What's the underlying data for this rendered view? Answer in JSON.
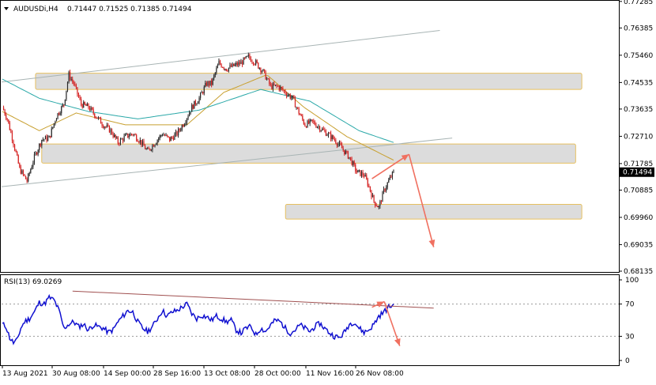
{
  "header": {
    "symbol": "AUDUSDi,H4",
    "ohlc": "0.71447 0.71525 0.71385 0.71494"
  },
  "rsi_header": "RSI(13) 69.0269",
  "current_price_label": "0.71494",
  "colors": {
    "candle_up": "#2a2a2a",
    "candle_down": "#d42020",
    "ma_fast": "#c8a030",
    "ma_slow": "#2aa8a8",
    "zone_fill": "#dcdcdc",
    "zone_border": "#e6c060",
    "trendline": "#a8b4b4",
    "arrow": "#f07060",
    "rsi_line": "#1010d0",
    "rsi_trendline": "#a05050",
    "price_tag_bg": "#000000"
  },
  "chart_data": [
    {
      "type": "candlestick",
      "symbol": "AUDUSDi",
      "timeframe": "H4",
      "ylim": [
        0.68135,
        0.7728
      ],
      "yticks": [
        "0.77285",
        "0.76385",
        "0.75460",
        "0.74535",
        "0.73635",
        "0.72710",
        "0.71785",
        "0.70885",
        "0.69960",
        "0.69035",
        "0.68135"
      ],
      "xticks": [
        "13 Aug 2021",
        "30 Aug 08:00",
        "14 Sep 00:00",
        "28 Sep 16:00",
        "13 Oct 08:00",
        "28 Oct 00:00",
        "11 Nov 16:00",
        "26 Nov 08:00"
      ],
      "approx_close_path": [
        [
          0,
          0.737
        ],
        [
          4,
          0.733
        ],
        [
          9,
          0.725
        ],
        [
          14,
          0.716
        ],
        [
          20,
          0.712
        ],
        [
          26,
          0.72
        ],
        [
          32,
          0.726
        ],
        [
          38,
          0.7265
        ],
        [
          44,
          0.734
        ],
        [
          50,
          0.738
        ],
        [
          54,
          0.748
        ],
        [
          58,
          0.745
        ],
        [
          64,
          0.738
        ],
        [
          70,
          0.737
        ],
        [
          76,
          0.734
        ],
        [
          82,
          0.731
        ],
        [
          88,
          0.729
        ],
        [
          94,
          0.725
        ],
        [
          100,
          0.727
        ],
        [
          106,
          0.728
        ],
        [
          112,
          0.7255
        ],
        [
          118,
          0.722
        ],
        [
          124,
          0.725
        ],
        [
          130,
          0.728
        ],
        [
          136,
          0.726
        ],
        [
          142,
          0.728
        ],
        [
          148,
          0.732
        ],
        [
          154,
          0.737
        ],
        [
          160,
          0.74
        ],
        [
          166,
          0.745
        ],
        [
          170,
          0.745
        ],
        [
          176,
          0.752
        ],
        [
          182,
          0.75
        ],
        [
          188,
          0.751
        ],
        [
          194,
          0.752
        ],
        [
          200,
          0.754
        ],
        [
          206,
          0.752
        ],
        [
          212,
          0.749
        ],
        [
          218,
          0.744
        ],
        [
          224,
          0.744
        ],
        [
          230,
          0.742
        ],
        [
          236,
          0.74
        ],
        [
          240,
          0.736
        ],
        [
          246,
          0.731
        ],
        [
          252,
          0.732
        ],
        [
          258,
          0.73
        ],
        [
          264,
          0.728
        ],
        [
          270,
          0.726
        ],
        [
          276,
          0.723
        ],
        [
          282,
          0.72
        ],
        [
          288,
          0.715
        ],
        [
          294,
          0.714
        ],
        [
          298,
          0.71
        ],
        [
          302,
          0.705
        ],
        [
          306,
          0.703
        ],
        [
          310,
          0.7085
        ],
        [
          314,
          0.712
        ],
        [
          318,
          0.7149
        ]
      ],
      "moving_averages": [
        {
          "color": "#c8a030",
          "approx_path": [
            [
              0,
              0.7355
            ],
            [
              30,
              0.729
            ],
            [
              60,
              0.735
            ],
            [
              100,
              0.731
            ],
            [
              150,
              0.731
            ],
            [
              180,
              0.742
            ],
            [
              215,
              0.748
            ],
            [
              245,
              0.737
            ],
            [
              280,
              0.727
            ],
            [
              318,
              0.719
            ]
          ]
        },
        {
          "color": "#2aa8a8",
          "approx_path": [
            [
              0,
              0.7465
            ],
            [
              30,
              0.74
            ],
            [
              70,
              0.7355
            ],
            [
              110,
              0.733
            ],
            [
              160,
              0.736
            ],
            [
              210,
              0.743
            ],
            [
              250,
              0.739
            ],
            [
              290,
              0.729
            ],
            [
              318,
              0.725
            ]
          ]
        }
      ],
      "zones": [
        {
          "from": 0.743,
          "to": 0.7485,
          "start": 0.055,
          "end": 0.94
        },
        {
          "from": 0.718,
          "to": 0.7245,
          "start": 0.065,
          "end": 0.93
        },
        {
          "from": 0.699,
          "to": 0.704,
          "start": 0.46,
          "end": 0.94
        }
      ],
      "trendlines": [
        {
          "from": [
            0,
            0.7455
          ],
          "to": [
            0.71,
            0.763
          ]
        },
        {
          "from": [
            0,
            0.71
          ],
          "to": [
            0.73,
            0.7265
          ]
        }
      ],
      "arrows": [
        {
          "from": [
            0.6,
            0.7127
          ],
          "to": [
            0.66,
            0.721
          ]
        },
        {
          "from": [
            0.66,
            0.721
          ],
          "to": [
            0.7,
            0.6895
          ]
        }
      ],
      "current_price": 0.71494
    },
    {
      "type": "line",
      "name": "RSI(13)",
      "ylim": [
        0,
        100
      ],
      "yticks": [
        "100",
        "70",
        "30",
        "0"
      ],
      "levels": [
        70,
        30
      ],
      "current_value": 69.0269,
      "approx_values": [
        [
          0,
          45
        ],
        [
          3,
          42
        ],
        [
          6,
          28
        ],
        [
          9,
          22
        ],
        [
          12,
          25
        ],
        [
          15,
          40
        ],
        [
          18,
          48
        ],
        [
          22,
          52
        ],
        [
          26,
          60
        ],
        [
          30,
          72
        ],
        [
          34,
          70
        ],
        [
          38,
          78
        ],
        [
          42,
          75
        ],
        [
          46,
          62
        ],
        [
          50,
          40
        ],
        [
          54,
          45
        ],
        [
          58,
          48
        ],
        [
          62,
          42
        ],
        [
          66,
          45
        ],
        [
          70,
          38
        ],
        [
          74,
          44
        ],
        [
          78,
          42
        ],
        [
          82,
          40
        ],
        [
          86,
          35
        ],
        [
          90,
          38
        ],
        [
          94,
          48
        ],
        [
          98,
          55
        ],
        [
          102,
          62
        ],
        [
          106,
          60
        ],
        [
          110,
          48
        ],
        [
          114,
          40
        ],
        [
          118,
          36
        ],
        [
          122,
          42
        ],
        [
          126,
          52
        ],
        [
          130,
          62
        ],
        [
          134,
          55
        ],
        [
          138,
          60
        ],
        [
          142,
          62
        ],
        [
          146,
          66
        ],
        [
          150,
          70
        ],
        [
          154,
          58
        ],
        [
          158,
          52
        ],
        [
          162,
          56
        ],
        [
          166,
          54
        ],
        [
          170,
          50
        ],
        [
          174,
          55
        ],
        [
          178,
          52
        ],
        [
          182,
          48
        ],
        [
          186,
          50
        ],
        [
          190,
          38
        ],
        [
          194,
          34
        ],
        [
          198,
          40
        ],
        [
          202,
          42
        ],
        [
          206,
          32
        ],
        [
          210,
          40
        ],
        [
          214,
          36
        ],
        [
          218,
          44
        ],
        [
          222,
          50
        ],
        [
          226,
          48
        ],
        [
          230,
          40
        ],
        [
          234,
          34
        ],
        [
          238,
          38
        ],
        [
          242,
          44
        ],
        [
          246,
          40
        ],
        [
          250,
          36
        ],
        [
          254,
          42
        ],
        [
          258,
          46
        ],
        [
          262,
          40
        ],
        [
          266,
          34
        ],
        [
          270,
          30
        ],
        [
          274,
          28
        ],
        [
          278,
          35
        ],
        [
          282,
          45
        ],
        [
          286,
          48
        ],
        [
          290,
          40
        ],
        [
          294,
          35
        ],
        [
          298,
          38
        ],
        [
          302,
          45
        ],
        [
          306,
          55
        ],
        [
          310,
          60
        ],
        [
          314,
          66
        ],
        [
          318,
          69
        ]
      ],
      "trendline": {
        "from": [
          0.115,
          86
        ],
        "to": [
          0.7,
          65
        ]
      },
      "arrows": [
        {
          "from": [
            0.6,
            66
          ],
          "to": [
            0.62,
            73
          ]
        },
        {
          "from": [
            0.62,
            73
          ],
          "to": [
            0.645,
            18
          ]
        }
      ]
    }
  ]
}
